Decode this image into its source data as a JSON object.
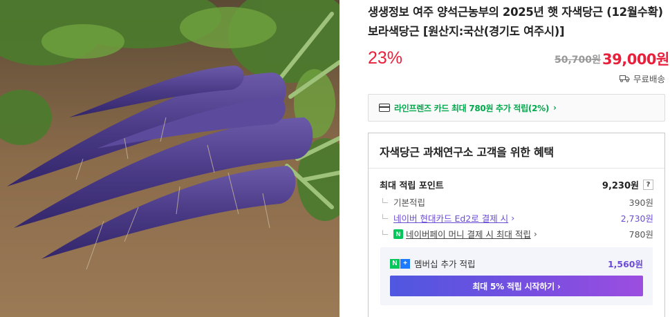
{
  "product": {
    "title": "생생정보 여주 양석근농부의 2025년 햇 자색당근 (12월수확)보라색당근 [원산지:국산(경기도 여주시)]",
    "discount": "23%",
    "original_price": "50,700원",
    "sale_price": "39,000원",
    "shipping": "무료배송",
    "icons": {
      "shipping": "truck-icon",
      "card": "credit-card-icon",
      "help": "question-icon"
    }
  },
  "card_promo": {
    "text": "라인프렌즈 카드 최대 780원 추가 적립(2%)",
    "chevron": "›"
  },
  "benefit": {
    "title": "자색당근 과채연구소 고객을 위한 혜택",
    "max_points_label": "최대 적립 포인트",
    "max_points_value": "9,230원",
    "help": "?",
    "rows": [
      {
        "label": "기본적립",
        "value": "390원"
      },
      {
        "label": "네이버 현대카드 Ed2로 결제 시",
        "value": "2,730원",
        "chevron": "›"
      },
      {
        "label": "네이버페이 머니 결제 시 최대 적립",
        "value": "780원",
        "chevron": "›",
        "badge": "N"
      }
    ],
    "membership": {
      "badge_n": "N",
      "badge_plus": "+",
      "label": "멤버십 추가 적립",
      "value": "1,560원",
      "button": "최대 5% 적립 시작하기 ›"
    }
  },
  "colors": {
    "accent_red": "#e8203c",
    "naver_green": "#03a94d",
    "purple": "#6b4bd6"
  }
}
